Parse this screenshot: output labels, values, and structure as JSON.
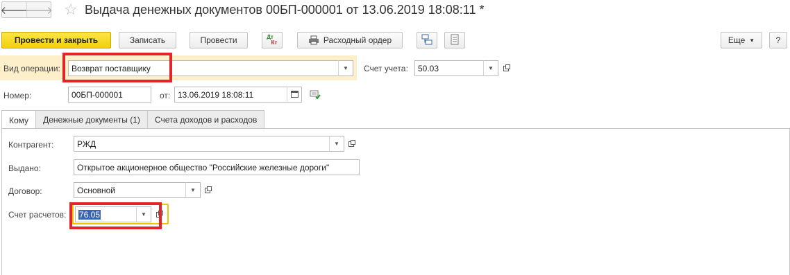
{
  "window": {
    "title": "Выдача денежных документов 00БП-000001 от 13.06.2019 18:08:11 *"
  },
  "toolbar": {
    "post_close": "Провести и закрыть",
    "save": "Записать",
    "post": "Провести",
    "dt_kt_top": "Дт",
    "dt_kt_bottom": "Кт",
    "cash_order": "Расходный ордер",
    "more": "Еще",
    "help": "?"
  },
  "form": {
    "operation_label": "Вид операции:",
    "operation_value": "Возврат поставщику",
    "account_label": "Счет учета:",
    "account_value": "50.03",
    "number_label": "Номер:",
    "number_value": "00БП-000001",
    "date_label": "от:",
    "date_value": "13.06.2019 18:08:11"
  },
  "tabs": [
    {
      "label": "Кому",
      "active": true
    },
    {
      "label": "Денежные документы (1)",
      "active": false
    },
    {
      "label": "Счета доходов и расходов",
      "active": false
    }
  ],
  "recipient": {
    "counterparty_label": "Контрагент:",
    "counterparty_value": "РЖД",
    "issued_label": "Выдано:",
    "issued_value": "Открытое акционерное общество \"Российские железные дороги\"",
    "contract_label": "Договор:",
    "contract_value": "Основной",
    "settlement_label": "Счет расчетов:",
    "settlement_value": "76.05"
  },
  "colors": {
    "primary_button": "#f3cf0a",
    "highlight_row": "#fcefc9",
    "annotation_red": "#e1252b",
    "selection": "#3a64b2",
    "focus_yellow": "#f2c200"
  }
}
